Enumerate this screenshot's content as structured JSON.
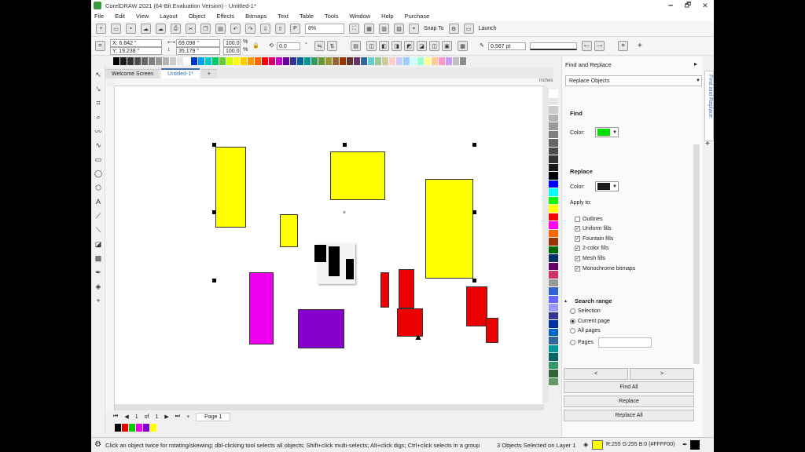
{
  "window": {
    "title": "CorelDRAW 2021 (64-Bit Evaluation Version) - Untitled-1*",
    "controls": [
      "🗕",
      "🗗",
      "✕"
    ]
  },
  "menu": [
    "File",
    "Edit",
    "View",
    "Layout",
    "Object",
    "Effects",
    "Bitmaps",
    "Text",
    "Table",
    "Tools",
    "Window",
    "Help",
    "Purchase"
  ],
  "toolbar": {
    "zoom": "8%",
    "snap_label": "Snap To",
    "launch_label": "Launch"
  },
  "properties": {
    "x": "X: 6.642 \"",
    "y": "Y: 19.238 \"",
    "width": "69.098 \"",
    "height": "35.179 \"",
    "scale_w": "100.0",
    "scale_h": "100.0",
    "pct": "%",
    "angle": "0.0",
    "angle_unit": "°",
    "outline_width": "0.567 pt"
  },
  "tabs": {
    "welcome": "Welcome Screen",
    "document": "Untitled-1*"
  },
  "ruler": {
    "unit": "inches"
  },
  "page_nav": {
    "current": "1",
    "of": "of",
    "total": "1",
    "page_tab": "Page 1"
  },
  "status": {
    "hint": "Click an object twice for rotating/skewing; dbl-clicking tool selects all objects; Shift+click multi-selects; Alt+click digs; Ctrl+click selects in a group",
    "selection": "3 Objects Selected on Layer 1",
    "fill_info": "R:255 G:255 B:0 (#FFFF00)"
  },
  "docker": {
    "title": "Find and Replace",
    "side_tab": "Find and Replace",
    "mode": "Replace Objects",
    "find_heading": "Find",
    "find_color_label": "Color:",
    "find_color": "#00e000",
    "replace_heading": "Replace",
    "replace_color_label": "Color:",
    "replace_color": "#1a1a1a",
    "apply_to_label": "Apply to:",
    "apply_options": [
      {
        "label": "Outlines",
        "checked": false
      },
      {
        "label": "Uniform fills",
        "checked": true
      },
      {
        "label": "Fountain fills",
        "checked": true
      },
      {
        "label": "2-color fills",
        "checked": true
      },
      {
        "label": "Mesh fills",
        "checked": true
      },
      {
        "label": "Monochrome bitmaps",
        "checked": true
      }
    ],
    "search_range_label": "Search range",
    "search_options": [
      {
        "label": "Selection",
        "selected": false
      },
      {
        "label": "Current page",
        "selected": true
      },
      {
        "label": "All pages",
        "selected": false
      },
      {
        "label": "Pages",
        "selected": false
      }
    ],
    "prev_label": "<",
    "next_label": ">",
    "find_all_label": "Find All",
    "replace_label": "Replace",
    "replace_all_label": "Replace All"
  },
  "colors": {
    "yellow": "#ffff00",
    "magenta": "#ee00ee",
    "purple": "#8800cc",
    "red": "#ee0000",
    "black": "#000000"
  },
  "palette_top": [
    "#000000",
    "#1a1a1a",
    "#333333",
    "#4d4d4d",
    "#666666",
    "#808080",
    "#999999",
    "#b3b3b3",
    "#cccccc",
    "#e6e6e6",
    "#ffffff",
    "#0033cc",
    "#00a0e9",
    "#00cccc",
    "#00cc66",
    "#66cc33",
    "#ccff00",
    "#ffff00",
    "#ffcc00",
    "#ff9900",
    "#ff6600",
    "#ff0000",
    "#cc0066",
    "#cc00cc",
    "#660099",
    "#333399",
    "#006699",
    "#009999",
    "#339966",
    "#669933",
    "#999933",
    "#996633",
    "#993300",
    "#663333",
    "#663366",
    "#336699",
    "#66cccc",
    "#99cc99",
    "#cccc99",
    "#ffcccc",
    "#ccccff",
    "#99ccff",
    "#ccffff",
    "#99ffcc",
    "#ffff99",
    "#ffcc99",
    "#ff99cc",
    "#cc99ff",
    "#c0c0c0",
    "#8c8c8c"
  ],
  "palette_side": [
    "#ffffff",
    "#e6e6e6",
    "#cccccc",
    "#b3b3b3",
    "#999999",
    "#808080",
    "#666666",
    "#4d4d4d",
    "#333333",
    "#1a1a1a",
    "#000000",
    "#0000ff",
    "#00ffff",
    "#00ff00",
    "#ffff00",
    "#ff0000",
    "#ff00ff",
    "#ff6600",
    "#993300",
    "#006600",
    "#003366",
    "#660066",
    "#cc3366",
    "#999999",
    "#3366cc",
    "#6666ff",
    "#9999ff",
    "#333399",
    "#003399",
    "#0066cc",
    "#336699",
    "#009999",
    "#006666",
    "#339966",
    "#336633",
    "#669966"
  ],
  "palette_bottom": [
    "#000000",
    "#ee0000",
    "#00cc00",
    "#ee00ee",
    "#8800cc",
    "#ffff00"
  ]
}
